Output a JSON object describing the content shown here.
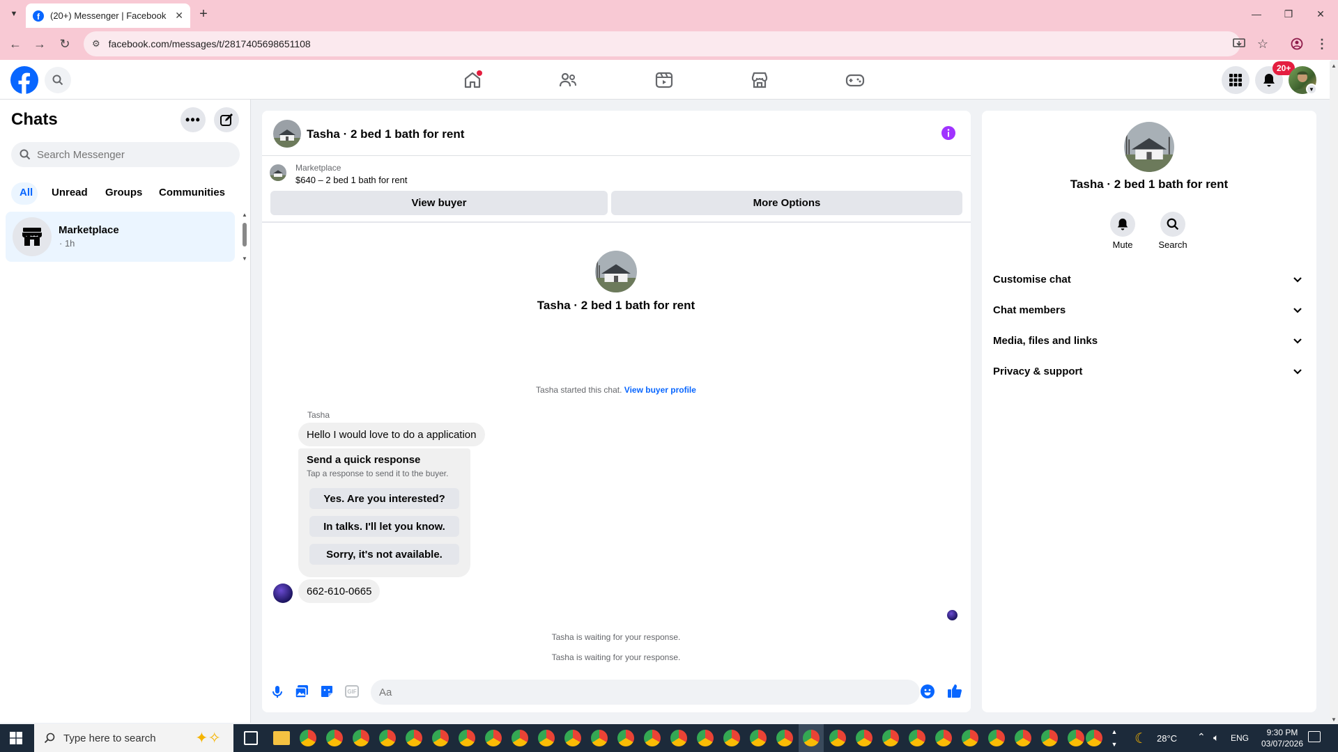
{
  "browser": {
    "tab_title": "(20+) Messenger | Facebook",
    "url": "facebook.com/messages/t/2817405698651108",
    "new_tab_label": "+"
  },
  "header": {
    "notifications_badge": "20+"
  },
  "chats": {
    "title": "Chats",
    "search_placeholder": "Search Messenger",
    "filters": [
      "All",
      "Unread",
      "Groups",
      "Communities"
    ],
    "active_filter": "All",
    "items": [
      {
        "name": "Marketplace",
        "meta": "· 1h"
      }
    ]
  },
  "conversation": {
    "title": "Tasha · 2 bed 1 bath for rent",
    "listing_source": "Marketplace",
    "listing_title": "$640 – 2 bed 1 bath for rent",
    "view_buyer_label": "View buyer",
    "more_options_label": "More Options",
    "intro_name": "Tasha · 2 bed 1 bath for rent",
    "started_text": "Tasha started this chat.",
    "view_profile_link": "View buyer profile",
    "sender_name": "Tasha",
    "first_message": "Hello I would love to do a application",
    "quick_response": {
      "title": "Send a quick response",
      "subtitle": "Tap a response to send it to the buyer.",
      "options": [
        "Yes. Are you interested?",
        "In talks. I'll let you know.",
        "Sorry, it's not available."
      ]
    },
    "second_message": "662-610-0665",
    "waiting_1": "Tasha is waiting for your response.",
    "waiting_2": "Tasha is waiting for your response.",
    "composer_placeholder": "Aa"
  },
  "info_panel": {
    "name": "Tasha · 2 bed 1 bath for rent",
    "mute_label": "Mute",
    "search_label": "Search",
    "sections": [
      "Customise chat",
      "Chat members",
      "Media, files and links",
      "Privacy & support"
    ]
  },
  "taskbar": {
    "search_placeholder": "Type here to search",
    "temperature": "28°C",
    "language": "ENG",
    "time": "9:30 PM",
    "date": "03/07/2026"
  },
  "colors": {
    "accent": "#0866ff",
    "messenger_purple": "#a033ff",
    "notification_red": "#e41e3f",
    "browser_frame": "#f8c9d4"
  }
}
